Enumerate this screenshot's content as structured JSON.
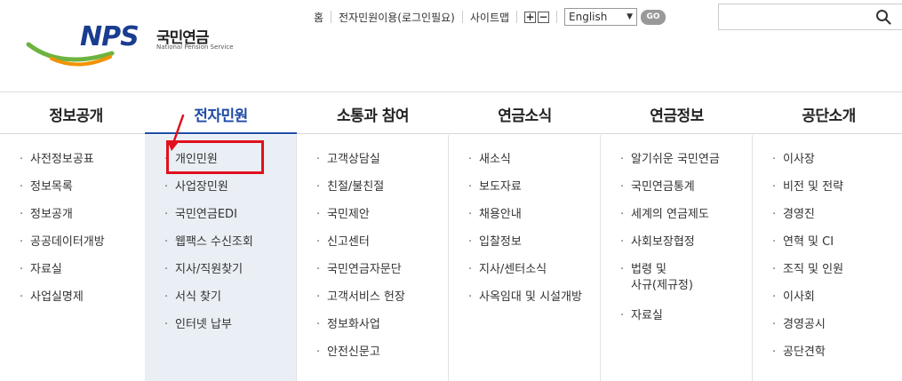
{
  "brand": {
    "logo_text": "NPS",
    "name_ko": "국민연금",
    "name_en": "National Pension Service",
    "colors": {
      "primary": "#1a3d8f",
      "accent_green": "#6db33f",
      "accent_orange": "#f39200",
      "highlight": "#e0101e",
      "active_nav": "#1d4aa6"
    }
  },
  "util": {
    "home": "홈",
    "epetition": "전자민원이용(로그인필요)",
    "sitemap": "사이트맵",
    "zoom_in": "+",
    "zoom_out": "−",
    "language": "English",
    "go": "GO"
  },
  "search": {
    "placeholder": "",
    "icon": "search-icon"
  },
  "nav": [
    {
      "label": "정보공개",
      "active": false
    },
    {
      "label": "전자민원",
      "active": true
    },
    {
      "label": "소통과 참여",
      "active": false
    },
    {
      "label": "연금소식",
      "active": false
    },
    {
      "label": "연금정보",
      "active": false
    },
    {
      "label": "공단소개",
      "active": false
    }
  ],
  "columns": [
    {
      "items": [
        "사전정보공표",
        "정보목록",
        "정보공개",
        "공공데이터개방",
        "자료실",
        "사업실명제"
      ]
    },
    {
      "items": [
        "개인민원",
        "사업장민원",
        "국민연금EDI",
        "웹팩스 수신조회",
        "지사/직원찾기",
        "서식 찾기",
        "인터넷 납부"
      ]
    },
    {
      "items": [
        "고객상담실",
        "친절/불친절",
        "국민제안",
        "신고센터",
        "국민연금자문단",
        "고객서비스 헌장",
        "정보화사업",
        "안전신문고"
      ]
    },
    {
      "items": [
        "새소식",
        "보도자료",
        "채용안내",
        "입찰정보",
        "지사/센터소식",
        "사옥임대 및 시설개방"
      ]
    },
    {
      "items": [
        "알기쉬운 국민연금",
        "국민연금통계",
        "세계의 연금제도",
        "사회보장협정",
        "법령 및",
        "사규(제규정)",
        "자료실"
      ]
    },
    {
      "items": [
        "이사장",
        "비전 및 전략",
        "경영진",
        "연혁 및 CI",
        "조직 및 인원",
        "이사회",
        "경영공시",
        "공단견학"
      ]
    }
  ]
}
